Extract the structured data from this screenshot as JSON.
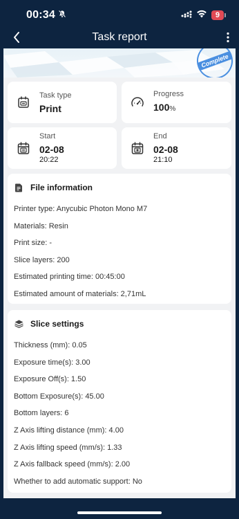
{
  "status": {
    "time": "00:34",
    "battery": "9"
  },
  "nav": {
    "title": "Task report"
  },
  "banner": {
    "stamp": "Complete"
  },
  "stats": {
    "task_type": {
      "label": "Task type",
      "value": "Print"
    },
    "progress": {
      "label": "Progress",
      "value": "100",
      "unit": "%"
    },
    "start": {
      "label": "Start",
      "date": "02-08",
      "time": "20:22"
    },
    "end": {
      "label": "End",
      "date": "02-08",
      "time": "21:10"
    }
  },
  "file_info": {
    "title": "File information",
    "rows": [
      "Printer type: Anycubic Photon Mono M7",
      "Materials: Resin",
      "Print size: -",
      "Slice layers: 200",
      "Estimated printing time: 00:45:00",
      "Estimated amount of materials: 2,71mL"
    ]
  },
  "slice": {
    "title": "Slice settings",
    "rows": [
      "Thickness (mm): 0.05",
      "Exposure time(s): 3.00",
      "Exposure Off(s): 1.50",
      "Bottom Exposure(s): 45.00",
      "Bottom layers: 6",
      "Z Axis lifting distance (mm): 4.00",
      "Z Axis lifting speed (mm/s): 1.33",
      "Z Axis fallback speed (mm/s): 2.00",
      "Whether to add automatic support: No"
    ]
  },
  "colors": {
    "nav_bg": "#0d2440",
    "content_bg": "#f1f2f4",
    "accent": "#4a8fe0",
    "battery": "#e04a55"
  }
}
